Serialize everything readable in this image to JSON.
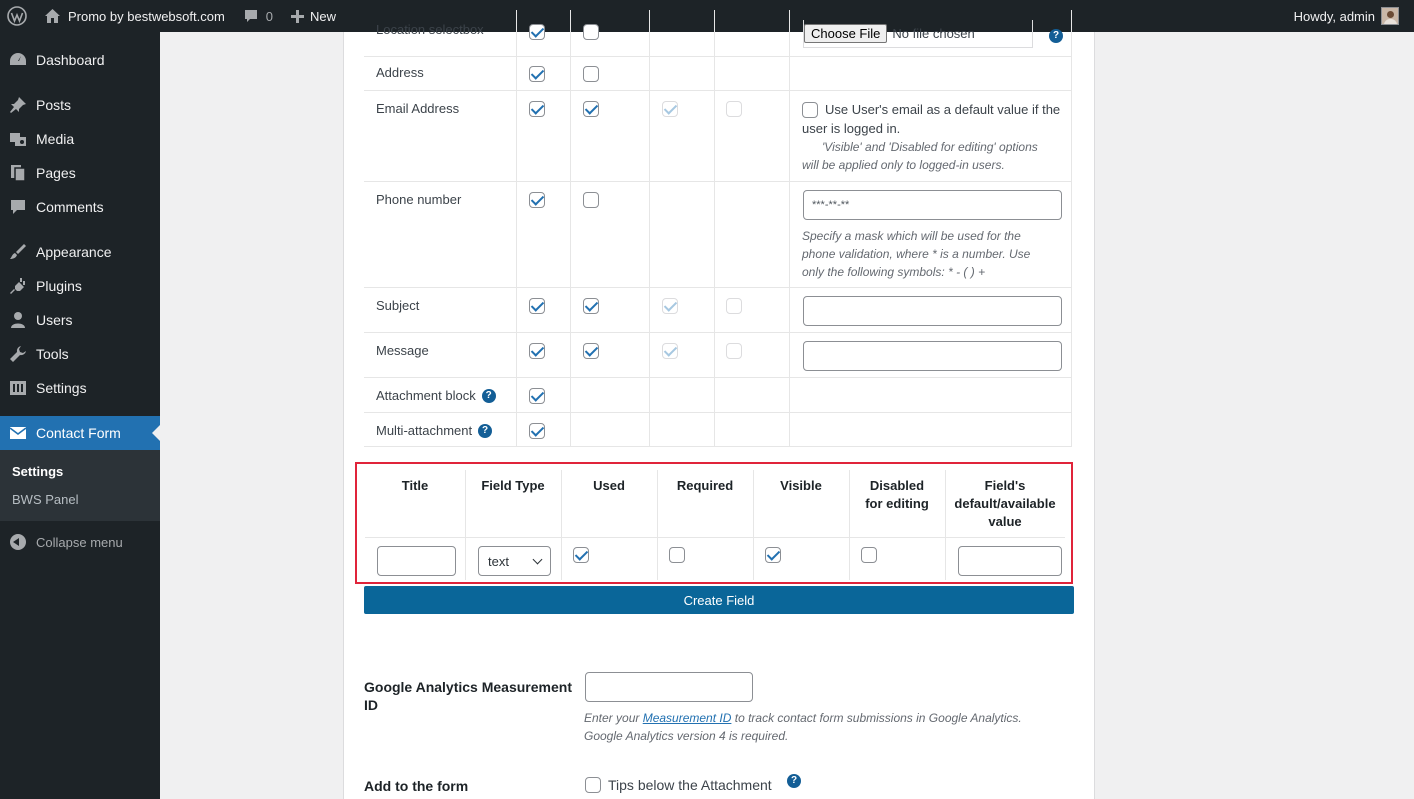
{
  "adminbar": {
    "site_name": "Promo by bestwebsoft.com",
    "comments_count": "0",
    "new_label": "New",
    "howdy": "Howdy, admin"
  },
  "sidebar": {
    "items": [
      {
        "label": "Dashboard",
        "icon": "dashboard-icon"
      },
      {
        "label": "Posts",
        "icon": "pin-icon"
      },
      {
        "label": "Media",
        "icon": "media-icon"
      },
      {
        "label": "Pages",
        "icon": "pages-icon"
      },
      {
        "label": "Comments",
        "icon": "comment-icon"
      },
      {
        "label": "Appearance",
        "icon": "brush-icon"
      },
      {
        "label": "Plugins",
        "icon": "plug-icon"
      },
      {
        "label": "Users",
        "icon": "user-icon"
      },
      {
        "label": "Tools",
        "icon": "wrench-icon"
      },
      {
        "label": "Settings",
        "icon": "settings-icon"
      },
      {
        "label": "Contact Form",
        "icon": "envelope-icon"
      }
    ],
    "submenu": [
      "Settings",
      "BWS Panel"
    ],
    "collapse": "Collapse menu"
  },
  "fields": {
    "location": {
      "label": "Location selectbox",
      "file_button": "Choose File",
      "file_status": "No file chosen"
    },
    "address": {
      "label": "Address"
    },
    "email": {
      "label": "Email Address",
      "option_line1": "Use User's email as a default value if the",
      "option_line2": "user is logged in.",
      "note_line1": "'Visible' and 'Disabled for editing' options",
      "note_line2": "will be applied only to logged-in users."
    },
    "phone": {
      "label": "Phone number",
      "mask": "***-**-**",
      "note_line1": "Specify a mask which will be used for the",
      "note_line2": "phone validation, where * is a number. Use",
      "note_line3": "only the following symbols: * - ( ) +"
    },
    "subject": {
      "label": "Subject"
    },
    "message": {
      "label": "Message"
    },
    "attachment": {
      "label": "Attachment block"
    },
    "multi": {
      "label": "Multi-attachment"
    }
  },
  "newfield": {
    "headers": {
      "title": "Title",
      "type": "Field Type",
      "used": "Used",
      "required": "Required",
      "visible": "Visible",
      "disabled_1": "Disabled",
      "disabled_2": "for editing",
      "default_1": "Field's",
      "default_2": "default/available",
      "default_3": "value"
    },
    "type_value": "text",
    "used": true,
    "required": false,
    "visible": true,
    "disabled": false,
    "create_button": "Create Field"
  },
  "analytics": {
    "label_1": "Google Analytics Measurement",
    "label_2": "ID",
    "note_pre": "Enter your ",
    "note_link": "Measurement ID",
    "note_post": " to track contact form submissions in Google Analytics.",
    "note_line2": "Google Analytics version 4 is required."
  },
  "addform": {
    "label": "Add to the form",
    "option": "Tips below the Attachment"
  },
  "colors": {
    "admin_bar": "#1d2327",
    "accent": "#2271b1",
    "create_button": "#0a6699",
    "highlight_border": "#e0243a"
  }
}
